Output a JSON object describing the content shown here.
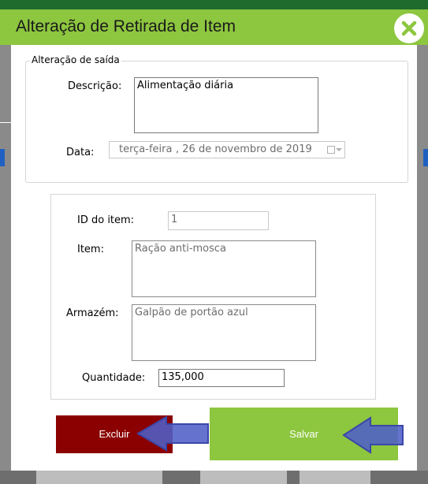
{
  "dialog": {
    "title": "Alteração de Retirada de Item"
  },
  "saida": {
    "legend": "Alteração de saída",
    "descricao_label": "Descrição:",
    "descricao_value": "Alimentação diária",
    "data_label": "Data:",
    "data_weekday": "terça-feira",
    "data_date": ", 26 de novembro de 2019"
  },
  "item": {
    "id_label": "ID do item:",
    "id_value": "1",
    "item_label": "Item:",
    "item_value": "Ração anti-mosca",
    "armazem_label": "Armazém:",
    "armazem_value": "Galpão de portão azul",
    "quantidade_label": "Quantidade:",
    "quantidade_value": "135,000"
  },
  "buttons": {
    "excluir": "Excluir",
    "salvar": "Salvar"
  },
  "colors": {
    "accent_green": "#8dc63f",
    "danger_red": "#8b0000",
    "annotation_arrow": "#5060c8"
  },
  "icons": {
    "close": "close-icon",
    "calendar": "calendar-icon",
    "arrow": "arrow-left-icon"
  }
}
